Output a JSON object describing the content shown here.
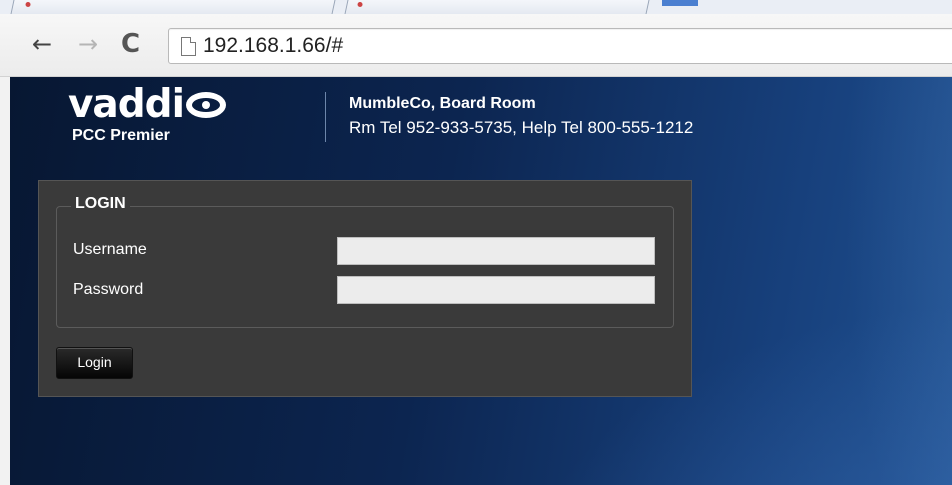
{
  "browser": {
    "url": "192.168.1.66/#",
    "nav": {
      "back": "←",
      "forward": "→",
      "reload": "C"
    }
  },
  "header": {
    "logo": "vaddi",
    "product": "PCC Premier",
    "site_name": "MumbleCo, Board Room",
    "site_phones": "Rm Tel 952-933-5735, Help Tel 800-555-1212"
  },
  "login": {
    "legend": "LOGIN",
    "username_label": "Username",
    "password_label": "Password",
    "username_value": "",
    "password_value": "",
    "button": "Login"
  },
  "colors": {
    "panel": "#3a3a3a",
    "background": "#0c2550",
    "input": "#ececec"
  }
}
